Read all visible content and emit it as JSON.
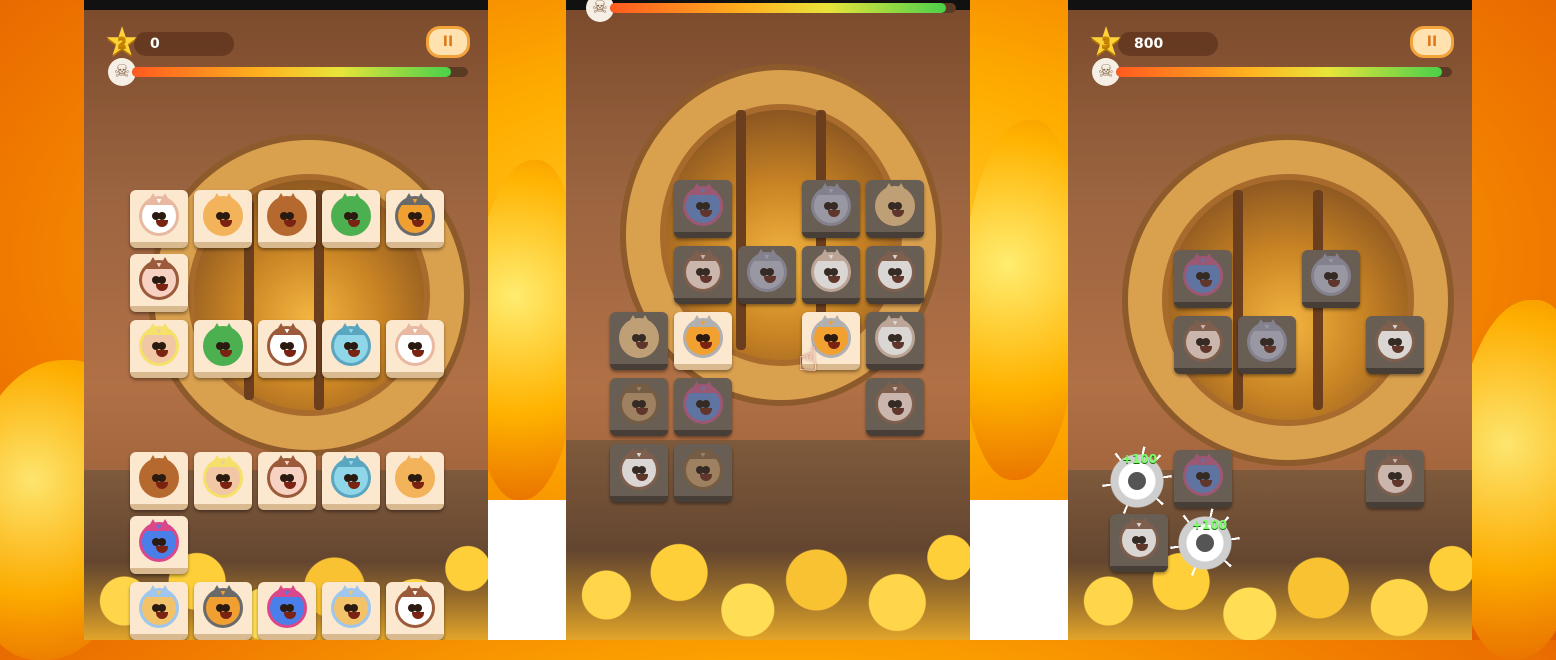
{
  "colors": {
    "accent": "#f2a33a",
    "tile": "#fbe8cf",
    "tile_dim": "#6f5d4a",
    "health_low": "#ff5a1f",
    "health_high": "#4ad04a",
    "score_bonus": "#7cff6a"
  },
  "screens": [
    {
      "star_level": "2",
      "score": "0",
      "pause_label": "II",
      "health": 0.95,
      "tiles": [
        "cat-lucky-icon",
        "doge-icon",
        "monkey-icon",
        "pepe-frog-icon",
        "shiba-helmet-icon",
        "cow-cat-icon",
        "trump-icon",
        "pepe-frog-icon",
        "cat-shout-icon",
        "robot-cat-icon",
        "cat-lucky-icon",
        "monkey-icon",
        "trump-icon",
        "cow-cat-icon",
        "robot-cat-icon",
        "doge-icon",
        "blue-cat-icon",
        "beer-dog-icon",
        "shiba-helmet-icon",
        "blue-cat-icon",
        "beer-dog-icon",
        "cat-shout-icon"
      ]
    },
    {
      "health": 0.97,
      "hand_icon": "pointer-hand-icon",
      "tiles": [
        "blue-cat-icon",
        "grey-cat-icon",
        "doge-icon",
        "cow-cat-icon",
        "grey-cat-icon",
        "cat-lucky-icon",
        "cat-shout-icon",
        "doge-icon",
        "viking-dog-icon",
        "viking-dog-icon",
        "cat-lucky-icon",
        "dog-icon",
        "blue-cat-icon",
        "cow-cat-icon",
        "cat-shout-icon",
        "dog-icon"
      ]
    },
    {
      "star_level": "3",
      "score": "800",
      "pause_label": "II",
      "health": 0.97,
      "tiles": [
        "blue-cat-icon",
        "grey-cat-icon",
        "cow-cat-icon",
        "grey-cat-icon",
        "cat-shout-icon",
        "blue-cat-icon",
        "cow-cat-icon",
        "cat-shout-icon"
      ],
      "bonus_labels": [
        "+100",
        "+100"
      ]
    }
  ]
}
